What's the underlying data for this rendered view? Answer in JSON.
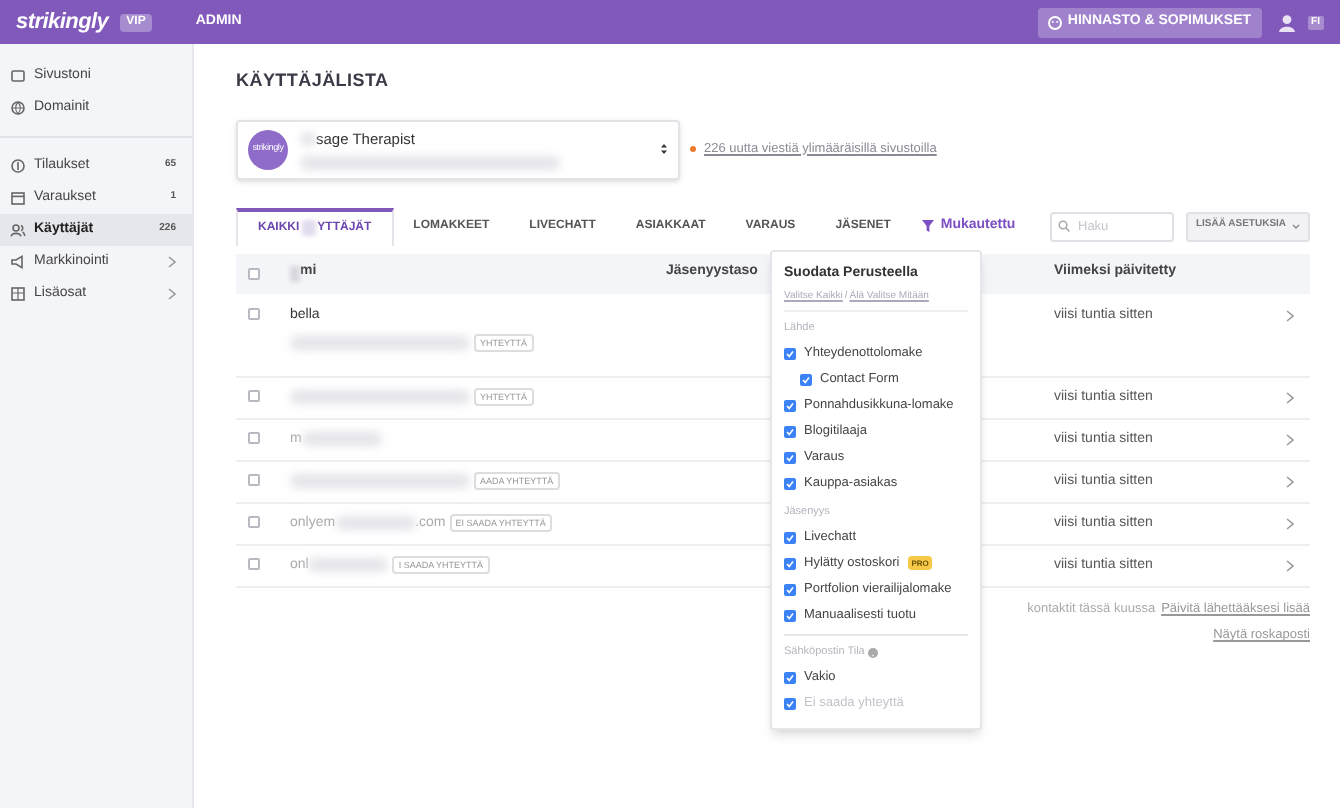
{
  "topbar": {
    "logo": "strikingly",
    "badge": "VIP",
    "admin": "ADMIN",
    "pricing_button": "HINNASTO & SOPIMUKSET",
    "language": "FI"
  },
  "sidebar": {
    "items": [
      {
        "label": "Sivustoni",
        "selected": false,
        "kind": "plain"
      },
      {
        "label": "Domainit",
        "selected": false,
        "kind": "plain"
      },
      {
        "label": "Tilaukset",
        "count": "65",
        "selected": false,
        "kind": "count"
      },
      {
        "label": "Varaukset",
        "count": "1",
        "selected": false,
        "kind": "count"
      },
      {
        "label": "Käyttäjät",
        "count": "226",
        "selected": true,
        "kind": "count"
      },
      {
        "label": "Markkinointi",
        "selected": false,
        "kind": "more"
      },
      {
        "label": "Lisäosat",
        "selected": false,
        "kind": "more"
      }
    ]
  },
  "page_title": "KÄYTTÄJÄLISTA",
  "site_selector": {
    "avatar": "strikingly",
    "name": "sage Therapist"
  },
  "alert_link": "226 uutta viestiä ylimääräisillä sivustoilla",
  "tabs": [
    {
      "label": "KAIKKI",
      "label_2": "YTTÄJÄT",
      "selected": true
    },
    {
      "label": "LOMAKKEET",
      "selected": false
    },
    {
      "label": "LIVECHATT",
      "selected": false
    },
    {
      "label": "ASIAKKAAT",
      "selected": false
    },
    {
      "label": "VARAUS",
      "selected": false
    },
    {
      "label": "JÄSENET",
      "selected": false
    }
  ],
  "custom_filter": "Mukautettu",
  "search": {
    "placeholder": "Haku"
  },
  "more_button": "LISÄÄ ASETUKSIA",
  "table": {
    "header_checked": false,
    "columns": [
      "mi",
      "Jäsenyystaso",
      "Viimeksi päivitetty"
    ],
    "rows": [
      {
        "checked": false,
        "name": "bella",
        "badge": "YHTEYTTÄ",
        "updated": "viisi tuntia sitten"
      },
      {
        "checked": false,
        "badge": "YHTEYTTÄ",
        "updated": "viisi tuntia sitten"
      },
      {
        "checked": false,
        "email": "m",
        "updated": "viisi tuntia sitten"
      },
      {
        "checked": false,
        "badge": "AADA YHTEYTTÄ",
        "updated": "viisi tuntia sitten"
      },
      {
        "checked": false,
        "email": "onlyem",
        "email_2": ".com",
        "badge": "EI SAADA YHTEYTTÄ",
        "updated": "viisi tuntia sitten"
      },
      {
        "checked": false,
        "email": "onl",
        "badge": "I SAADA YHTEYTTÄ",
        "updated": "viisi tuntia sitten"
      }
    ]
  },
  "footer": {
    "note": "kontaktit tässä kuussa",
    "upgrade_link": "Päivitä lähettääksesi lisää",
    "spam_link": "Näytä roskaposti"
  },
  "filter_menu": {
    "title": "Suodata Perusteella",
    "select_all": "Valitse Kaikki",
    "separator": "/",
    "select_none": "Älä Valitse Mitään",
    "items": [
      {
        "kind": "header",
        "label": "Lähde"
      },
      {
        "kind": "option",
        "label": "Yhteydenottolomake",
        "checked": true,
        "children": [
          {
            "kind": "option",
            "label": "Contact Form",
            "checked": true
          }
        ]
      },
      {
        "kind": "option",
        "label": "Ponnahdusikkuna-lomake",
        "checked": true
      },
      {
        "kind": "option",
        "label": "Blogitilaaja",
        "checked": true
      },
      {
        "kind": "option",
        "label": "Varaus",
        "checked": true
      },
      {
        "kind": "option",
        "label": "Kauppa-asiakas",
        "checked": true
      },
      {
        "kind": "header",
        "label": "Jäsenyys"
      },
      {
        "kind": "option",
        "label": "Livechatt",
        "checked": true
      },
      {
        "kind": "option",
        "label": "Hylätty ostoskori",
        "checked": true,
        "badge": "PRO"
      },
      {
        "kind": "option",
        "label": "Portfolion vierailijalomake",
        "checked": true
      },
      {
        "kind": "option",
        "label": "Manuaalisesti tuotu",
        "checked": true
      },
      {
        "kind": "divider"
      },
      {
        "kind": "header",
        "label": "Sähköpostin Tila",
        "help": true
      },
      {
        "kind": "option",
        "label": "Vakio",
        "checked": true
      },
      {
        "kind": "option",
        "label": "Ei saada yhteyttä",
        "checked": true,
        "disabled": true
      }
    ]
  }
}
